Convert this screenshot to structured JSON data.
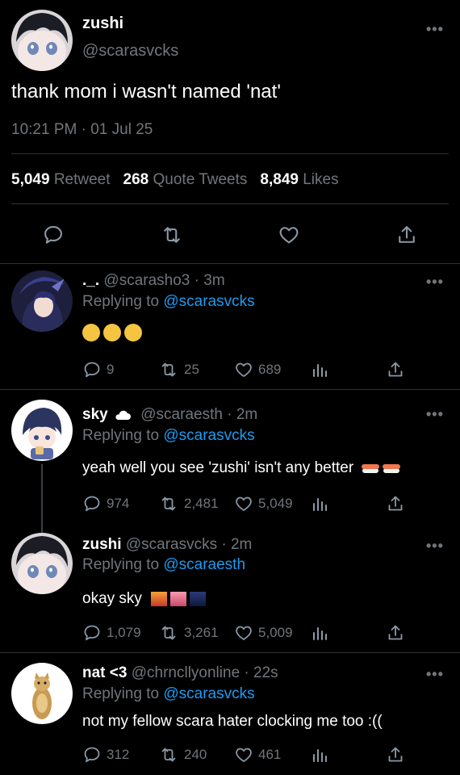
{
  "main_tweet": {
    "name": "zushi",
    "handle": "@scarasvcks",
    "text": "thank mom i wasn't named 'nat'",
    "timestamp": "10:21 PM · 01 Jul 25",
    "stats": {
      "retweets": "5,049",
      "retweets_label": "Retweet",
      "quotes": "268",
      "quotes_label": "Quote Tweets",
      "likes": "8,849",
      "likes_label": "Likes"
    }
  },
  "replies": [
    {
      "name": "._.",
      "handle": "@scarasho3",
      "time": "3m",
      "replying_prefix": "Replying to",
      "replying_to": "@scarasvcks",
      "text": "😭😭😭",
      "replies": "9",
      "retweets": "25",
      "likes": "689"
    },
    {
      "name": "sky",
      "name_icon": "cloud-icon",
      "handle": "@scaraesth",
      "time": "2m",
      "replying_prefix": "Replying to",
      "replying_to": "@scarasvcks",
      "text": "yeah well you see 'zushi' isn't any better",
      "replies": "974",
      "retweets": "2,481",
      "likes": "5,049"
    },
    {
      "name": "zushi",
      "handle": "@scarasvcks",
      "time": "2m",
      "replying_prefix": "Replying to",
      "replying_to": "@scaraesth",
      "text": "okay sky",
      "replies": "1,079",
      "retweets": "3,261",
      "likes": "5,009"
    },
    {
      "name": "nat <3",
      "handle": "@chrncllyonline",
      "time": "22s",
      "replying_prefix": "Replying to",
      "replying_to": "@scarasvcks",
      "text": "not my fellow scara hater clocking me too :((",
      "replies": "312",
      "retweets": "240",
      "likes": "461"
    }
  ],
  "separator": " · ",
  "colors": {
    "background": "#000000",
    "text": "#e7e9ea",
    "muted": "#71767b",
    "link": "#1d9bf0",
    "divider": "#2f3336"
  }
}
